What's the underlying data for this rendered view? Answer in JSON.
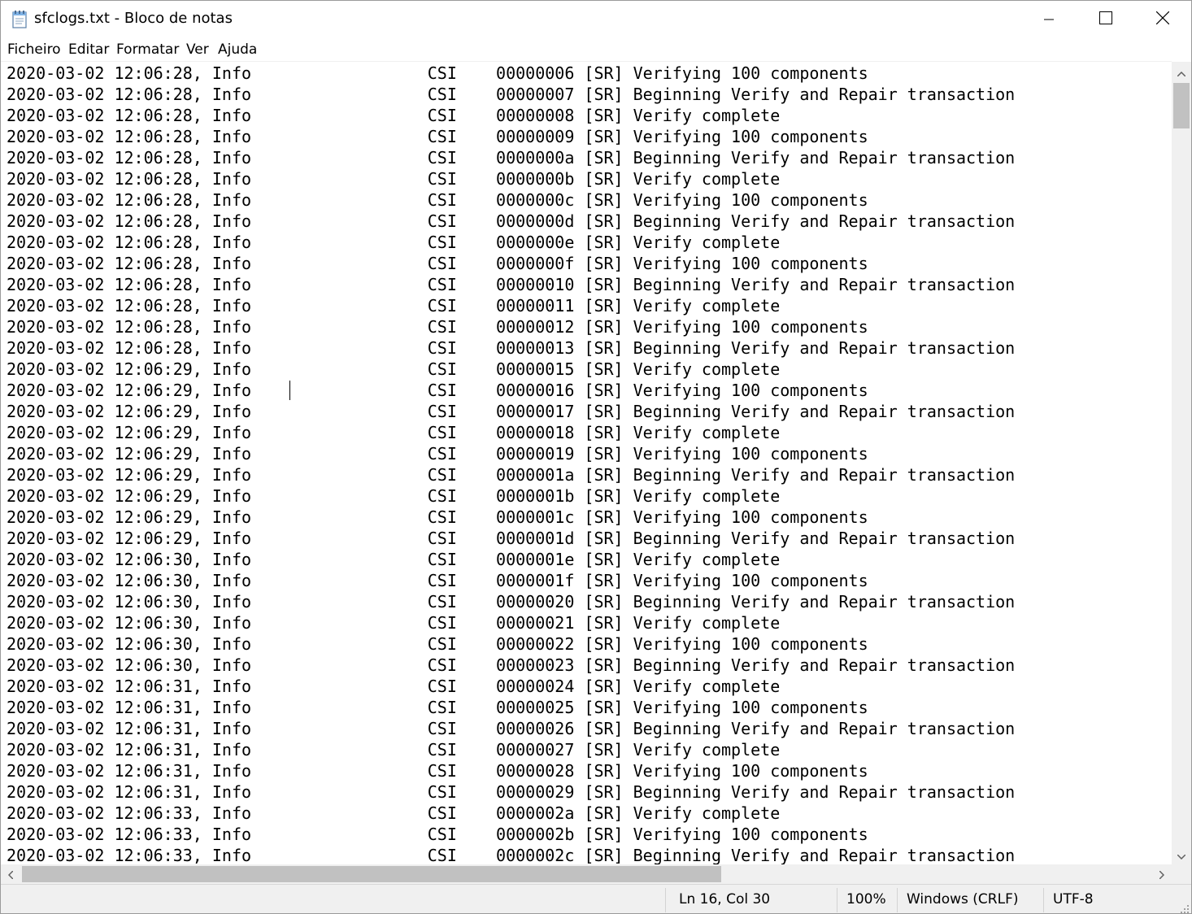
{
  "window": {
    "title": "sfclogs.txt - Bloco de notas",
    "app_icon": "notepad-icon",
    "controls": {
      "minimize": "minimize-icon",
      "maximize": "maximize-icon",
      "close": "close-icon"
    }
  },
  "menu": [
    "Ficheiro",
    "Editar",
    "Formatar",
    "Ver",
    "Ajuda"
  ],
  "editor": {
    "lines": [
      "2020-03-02 12:06:28, Info                  CSI    00000006 [SR] Verifying 100 components",
      "2020-03-02 12:06:28, Info                  CSI    00000007 [SR] Beginning Verify and Repair transaction",
      "2020-03-02 12:06:28, Info                  CSI    00000008 [SR] Verify complete",
      "2020-03-02 12:06:28, Info                  CSI    00000009 [SR] Verifying 100 components",
      "2020-03-02 12:06:28, Info                  CSI    0000000a [SR] Beginning Verify and Repair transaction",
      "2020-03-02 12:06:28, Info                  CSI    0000000b [SR] Verify complete",
      "2020-03-02 12:06:28, Info                  CSI    0000000c [SR] Verifying 100 components",
      "2020-03-02 12:06:28, Info                  CSI    0000000d [SR] Beginning Verify and Repair transaction",
      "2020-03-02 12:06:28, Info                  CSI    0000000e [SR] Verify complete",
      "2020-03-02 12:06:28, Info                  CSI    0000000f [SR] Verifying 100 components",
      "2020-03-02 12:06:28, Info                  CSI    00000010 [SR] Beginning Verify and Repair transaction",
      "2020-03-02 12:06:28, Info                  CSI    00000011 [SR] Verify complete",
      "2020-03-02 12:06:28, Info                  CSI    00000012 [SR] Verifying 100 components",
      "2020-03-02 12:06:28, Info                  CSI    00000013 [SR] Beginning Verify and Repair transaction",
      "2020-03-02 12:06:29, Info                  CSI    00000015 [SR] Verify complete",
      "2020-03-02 12:06:29, Info                  CSI    00000016 [SR] Verifying 100 components",
      "2020-03-02 12:06:29, Info                  CSI    00000017 [SR] Beginning Verify and Repair transaction",
      "2020-03-02 12:06:29, Info                  CSI    00000018 [SR] Verify complete",
      "2020-03-02 12:06:29, Info                  CSI    00000019 [SR] Verifying 100 components",
      "2020-03-02 12:06:29, Info                  CSI    0000001a [SR] Beginning Verify and Repair transaction",
      "2020-03-02 12:06:29, Info                  CSI    0000001b [SR] Verify complete",
      "2020-03-02 12:06:29, Info                  CSI    0000001c [SR] Verifying 100 components",
      "2020-03-02 12:06:29, Info                  CSI    0000001d [SR] Beginning Verify and Repair transaction",
      "2020-03-02 12:06:30, Info                  CSI    0000001e [SR] Verify complete",
      "2020-03-02 12:06:30, Info                  CSI    0000001f [SR] Verifying 100 components",
      "2020-03-02 12:06:30, Info                  CSI    00000020 [SR] Beginning Verify and Repair transaction",
      "2020-03-02 12:06:30, Info                  CSI    00000021 [SR] Verify complete",
      "2020-03-02 12:06:30, Info                  CSI    00000022 [SR] Verifying 100 components",
      "2020-03-02 12:06:30, Info                  CSI    00000023 [SR] Beginning Verify and Repair transaction",
      "2020-03-02 12:06:31, Info                  CSI    00000024 [SR] Verify complete",
      "2020-03-02 12:06:31, Info                  CSI    00000025 [SR] Verifying 100 components",
      "2020-03-02 12:06:31, Info                  CSI    00000026 [SR] Beginning Verify and Repair transaction",
      "2020-03-02 12:06:31, Info                  CSI    00000027 [SR] Verify complete",
      "2020-03-02 12:06:31, Info                  CSI    00000028 [SR] Verifying 100 components",
      "2020-03-02 12:06:31, Info                  CSI    00000029 [SR] Beginning Verify and Repair transaction",
      "2020-03-02 12:06:33, Info                  CSI    0000002a [SR] Verify complete",
      "2020-03-02 12:06:33, Info                  CSI    0000002b [SR] Verifying 100 components",
      "2020-03-02 12:06:33, Info                  CSI    0000002c [SR] Beginning Verify and Repair transaction"
    ]
  },
  "statusbar": {
    "position": "Ln 16, Col 30",
    "zoom": "100%",
    "line_ending": "Windows (CRLF)",
    "encoding": "UTF-8"
  },
  "colors": {
    "scrollbar_track": "#f0f0f0",
    "scrollbar_thumb": "#c1c1c1",
    "statusbar_bg": "#f0f0f0"
  }
}
